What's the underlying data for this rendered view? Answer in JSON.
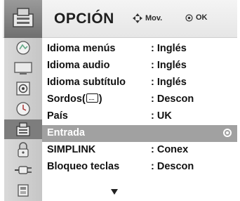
{
  "header": {
    "title": "OPCIÓN",
    "move_hint": "Mov.",
    "ok_hint": "OK",
    "icon": "option-icon"
  },
  "sidebar": {
    "items": [
      {
        "icon": "picture-icon"
      },
      {
        "icon": "screen-icon"
      },
      {
        "icon": "audio-icon"
      },
      {
        "icon": "clock-icon"
      },
      {
        "icon": "option-icon",
        "active": true
      },
      {
        "icon": "lock-icon"
      },
      {
        "icon": "input-plug-icon"
      },
      {
        "icon": "usb-icon"
      }
    ]
  },
  "menu": {
    "rows": [
      {
        "label": "Idioma menús",
        "value": ": Inglés"
      },
      {
        "label": "Idioma audio",
        "value": ": Inglés"
      },
      {
        "label": "Idioma subtítulo",
        "value": ": Inglés"
      },
      {
        "label_prefix": "Sordos(",
        "label_suffix": ")",
        "value": ": Descon"
      },
      {
        "label": "País",
        "value": ": UK"
      },
      {
        "label": "Entrada",
        "value": "",
        "selected": true
      },
      {
        "label": "SIMPLINK",
        "value": ": Conex"
      },
      {
        "label": "Bloqueo teclas",
        "value": ": Descon"
      }
    ]
  },
  "colors": {
    "selected_row": "#a1a1a1",
    "header_icon_bg": "#7f7f7f",
    "sidebar_active": "#7d7d7d"
  }
}
